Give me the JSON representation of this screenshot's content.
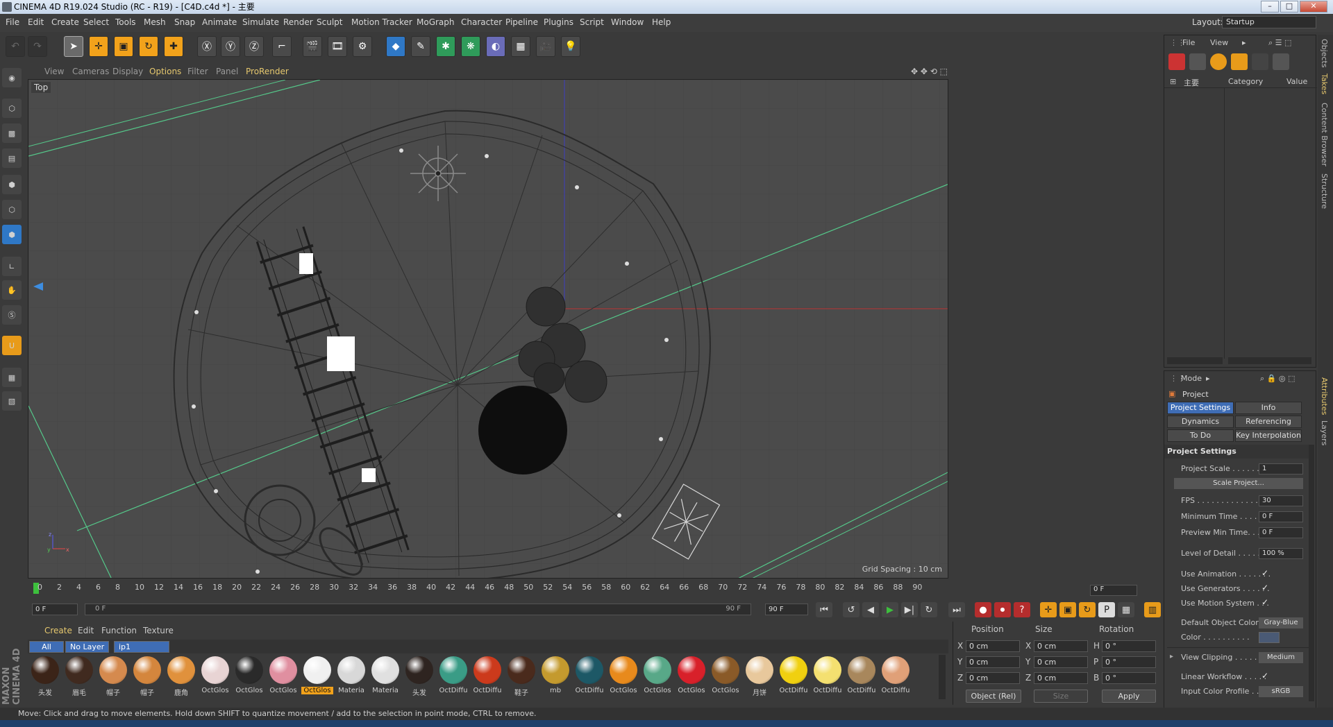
{
  "window": {
    "title": "CINEMA 4D R19.024 Studio (RC - R19) - [C4D.c4d *] - 主要",
    "minimize": "–",
    "maximize": "□",
    "close": "✕"
  },
  "menu": {
    "items": [
      "File",
      "Edit",
      "Create",
      "Select",
      "Tools",
      "Mesh",
      "Snap",
      "Animate",
      "Simulate",
      "Render",
      "Sculpt",
      "Motion Tracker",
      "MoGraph",
      "Character",
      "Pipeline",
      "Plugins",
      "Script",
      "Window",
      "Help"
    ],
    "layout_label": "Layout:",
    "layout_value": "Startup"
  },
  "viewport": {
    "menu": [
      "View",
      "Cameras",
      "Display",
      "Options",
      "Filter",
      "Panel",
      "ProRender"
    ],
    "highlight": [
      "Options",
      "ProRender"
    ],
    "view_name": "Top",
    "grid_spacing": "Grid Spacing : 10 cm"
  },
  "timeline": {
    "ticks": [
      "0",
      "2",
      "4",
      "6",
      "8",
      "10",
      "12",
      "14",
      "16",
      "18",
      "20",
      "22",
      "24",
      "26",
      "28",
      "30",
      "32",
      "34",
      "36",
      "38",
      "40",
      "42",
      "44",
      "46",
      "48",
      "50",
      "52",
      "54",
      "56",
      "58",
      "60",
      "62",
      "64",
      "66",
      "68",
      "70",
      "72",
      "74",
      "76",
      "78",
      "80",
      "82",
      "84",
      "86",
      "88",
      "90"
    ],
    "current_frame": "0 F",
    "start_field": "0 F",
    "range_start": "0 F",
    "range_end": "90 F",
    "end_field": "90 F"
  },
  "material_manager": {
    "menu": [
      "Create",
      "Edit",
      "Function",
      "Texture"
    ],
    "tabs": [
      "All",
      "No Layer",
      "ip1"
    ],
    "materials": [
      {
        "label": "头发",
        "color": "#3b2418"
      },
      {
        "label": "眉毛",
        "color": "#402a1f"
      },
      {
        "label": "帽子",
        "color": "#d58a4e"
      },
      {
        "label": "帽子",
        "color": "#d4863d"
      },
      {
        "label": "鹿角",
        "color": "#e0913c"
      },
      {
        "label": "OctGlos",
        "color": "#e8d4d4"
      },
      {
        "label": "OctGlos",
        "color": "#2a2a2a"
      },
      {
        "label": "OctGlos",
        "color": "#e08fa0"
      },
      {
        "label": "OctGlos",
        "color": "#f0f0f0"
      },
      {
        "label": "Materia",
        "color": "#d8d8d8"
      },
      {
        "label": "Materia",
        "color": "#e0e0e0"
      },
      {
        "label": "头发",
        "color": "#2e2420"
      },
      {
        "label": "OctDiffu",
        "color": "#3a9c86"
      },
      {
        "label": "OctDiffu",
        "color": "#cc3a1c"
      },
      {
        "label": "鞋子",
        "color": "#4a2a1c"
      },
      {
        "label": "mb",
        "color": "#c49a2e"
      },
      {
        "label": "OctDiffu",
        "color": "#1d5866"
      },
      {
        "label": "OctGlos",
        "color": "#e88a1c"
      },
      {
        "label": "OctGlos",
        "color": "#58a888"
      },
      {
        "label": "OctGlos",
        "color": "#d8202a"
      },
      {
        "label": "OctGlos",
        "color": "#8a5a28"
      },
      {
        "label": "月饼",
        "color": "#e8c89c"
      },
      {
        "label": "OctDiffu",
        "color": "#f0d010"
      },
      {
        "label": "OctDiffu",
        "color": "#f4e070"
      },
      {
        "label": "OctDiffu",
        "color": "#a8875c"
      },
      {
        "label": "OctDiffu",
        "color": "#e0a078"
      }
    ],
    "selected_index": 8
  },
  "coords": {
    "headers": [
      "Position",
      "Size",
      "Rotation"
    ],
    "rows": [
      {
        "axis": "X",
        "pos": "0 cm",
        "saxis": "X",
        "size": "0 cm",
        "raxis": "H",
        "rot": "0 °"
      },
      {
        "axis": "Y",
        "pos": "0 cm",
        "saxis": "Y",
        "size": "0 cm",
        "raxis": "P",
        "rot": "0 °"
      },
      {
        "axis": "Z",
        "pos": "0 cm",
        "saxis": "Z",
        "size": "0 cm",
        "raxis": "B",
        "rot": "0 °"
      }
    ],
    "mode": "Object (Rel)",
    "size_mode": "Size",
    "apply": "Apply"
  },
  "objects_panel": {
    "menu": [
      "File",
      "View"
    ],
    "col_name": "主要",
    "col_category": "Category",
    "col_value": "Value"
  },
  "attributes": {
    "menu": "Mode",
    "title": "Project",
    "tabs": [
      "Project Settings",
      "Info",
      "Dynamics",
      "Referencing",
      "To Do",
      "Key Interpolation"
    ],
    "section": "Project Settings",
    "rows": [
      {
        "label": "Project Scale . . . . . . .",
        "value": "1"
      },
      {
        "label": "FPS . . . . . . . . . . . . . . .",
        "value": "30"
      },
      {
        "label": "Minimum Time . . . . . . .",
        "value": "0 F"
      },
      {
        "label": "Preview Min Time. . . . .",
        "value": "0 F"
      },
      {
        "label": "Level of Detail . . . . . . .",
        "value": "100 %"
      }
    ],
    "scale_button": "Scale Project...",
    "checks": [
      {
        "label": "Use Animation . . . . . . .",
        "value": "✓"
      },
      {
        "label": "Use Generators . . . . . .",
        "value": "✓"
      },
      {
        "label": "Use Motion System . . .",
        "value": "✓"
      }
    ],
    "default_color_label": "Default Object Color",
    "default_color_value": "Gray-Blue",
    "color_label": "Color . . . . . . . . . .",
    "view_clipping_label": "View Clipping . . . . . . .",
    "view_clipping_value": "Medium",
    "linear_workflow_label": "Linear Workflow . . . . .",
    "linear_workflow_value": "✓",
    "input_color_label": "Input Color Profile . . .",
    "input_color_value": "sRGB"
  },
  "side_tabs": [
    "Objects",
    "Takes",
    "Content Browser",
    "Structure",
    "Attributes",
    "Layers"
  ],
  "status": "Move: Click and drag to move elements. Hold down SHIFT to quantize movement / add to the selection in point mode, CTRL to remove.",
  "logo": "MAXON CINEMA 4D"
}
